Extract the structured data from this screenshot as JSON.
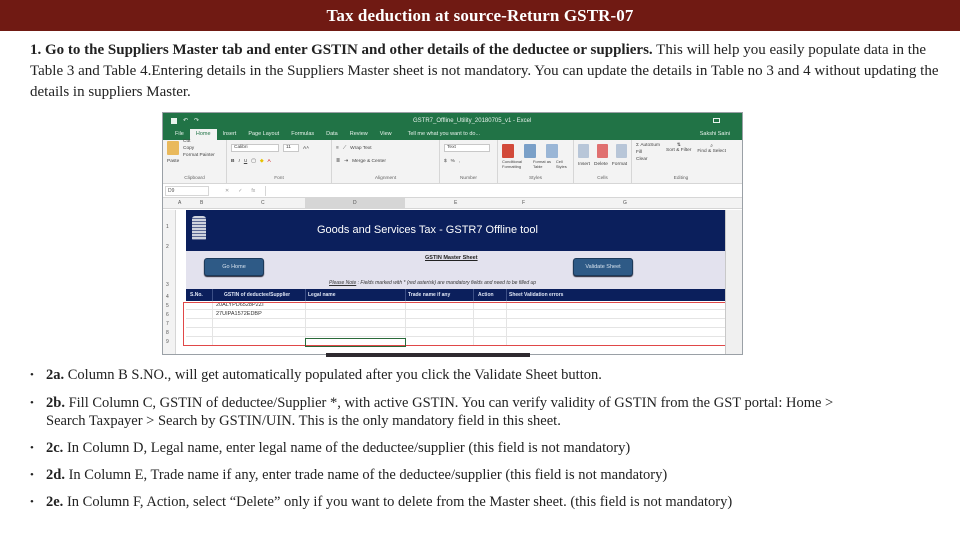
{
  "header": {
    "title": "Tax deduction at source-Return GSTR-07"
  },
  "intro": {
    "bold": "1. Go to the Suppliers Master tab and enter GSTIN and other details of the deductee or suppliers.",
    "text": " This will help you easily populate data in the Table 3 and Table 4.Entering details in the Suppliers Master sheet is not mandatory. You can update the details in Table no 3 and 4 without updating the details in suppliers Master."
  },
  "excel": {
    "window_title": "GSTR7_Offline_Utility_20180705_v1 - Excel",
    "tabs": [
      "File",
      "Home",
      "Insert",
      "Page Layout",
      "Formulas",
      "Data",
      "Review",
      "View"
    ],
    "active_tab": "Home",
    "tell_me": "Tell me what you want to do...",
    "user": "Sakshi Saini",
    "ribbon": {
      "clipboard": {
        "paste": "Paste",
        "cut": "Cut",
        "copy": "Copy",
        "format_painter": "Format Painter",
        "label": "Clipboard"
      },
      "font": {
        "name": "Calibri",
        "size": "11",
        "label": "Font"
      },
      "alignment": {
        "wrap": "Wrap Text",
        "merge": "Merge & Center",
        "label": "Alignment"
      },
      "number": {
        "format": "Text",
        "label": "Number"
      },
      "styles": {
        "cond": "Conditional Formatting",
        "table": "Format as Table",
        "cell": "Cell Styles",
        "label": "Styles"
      },
      "cells": {
        "insert": "Insert",
        "delete": "Delete",
        "format": "Format",
        "label": "Cells"
      },
      "editing": {
        "autosum": "AutoSum",
        "fill": "Fill",
        "clear": "Clear",
        "sort": "Sort & Filter",
        "find": "Find & Select",
        "label": "Editing"
      }
    },
    "name_box": "D9",
    "columns": [
      "A",
      "B",
      "C",
      "D",
      "E",
      "F",
      "G"
    ],
    "rows": [
      "1",
      "2",
      "3",
      "4",
      "5",
      "6",
      "7",
      "8",
      "9"
    ],
    "banner_title": "Goods and Services Tax - GSTR7 Offline tool",
    "go_home": "Go Home",
    "validate_sheet": "Validate Sheet",
    "master_title": "GSTIN Master Sheet",
    "note_label": "Please Note",
    "note_text": " : Fields marked with * (red asterisk) are mandatory fields and need to be filled up",
    "table_headers": [
      "S.No.",
      "GSTIN of deductee/Supplier",
      "Legal name",
      "Trade name if any",
      "Action",
      "Sheet Validation errors"
    ],
    "table_rows": [
      {
        "gstin": "20ALYPD6528P2ZI"
      },
      {
        "gstin": "27UIPA1572EDBP"
      },
      {
        "gstin": ""
      },
      {
        "gstin": ""
      },
      {
        "gstin": ""
      }
    ]
  },
  "bullets": [
    {
      "label": "2a.",
      "text": " Column B S.NO., will get automatically populated after you click the Validate Sheet button."
    },
    {
      "label": "2b.",
      "text": " Fill Column C, GSTIN of deductee/Supplier *, with active GSTIN. You can verify validity of GSTIN from the GST portal: Home > Search Taxpayer > Search by GSTIN/UIN. This is the only mandatory field in this sheet."
    },
    {
      "label": "2c.",
      "text": " In Column D, Legal name, enter legal name of the deductee/supplier (this field is not mandatory)"
    },
    {
      "label": "2d.",
      "text": " In Column E, Trade name if any, enter trade name of the deductee/supplier (this field is not mandatory)"
    },
    {
      "label": "2e.",
      "text": " In Column F, Action, select “Delete” only if you want to delete from the Master sheet. (this field is not mandatory)"
    }
  ],
  "colors": {
    "header_bg": "#701a13",
    "excel_green": "#217346",
    "banner_navy": "#0b1f5c",
    "highlight_red": "#e04848"
  }
}
